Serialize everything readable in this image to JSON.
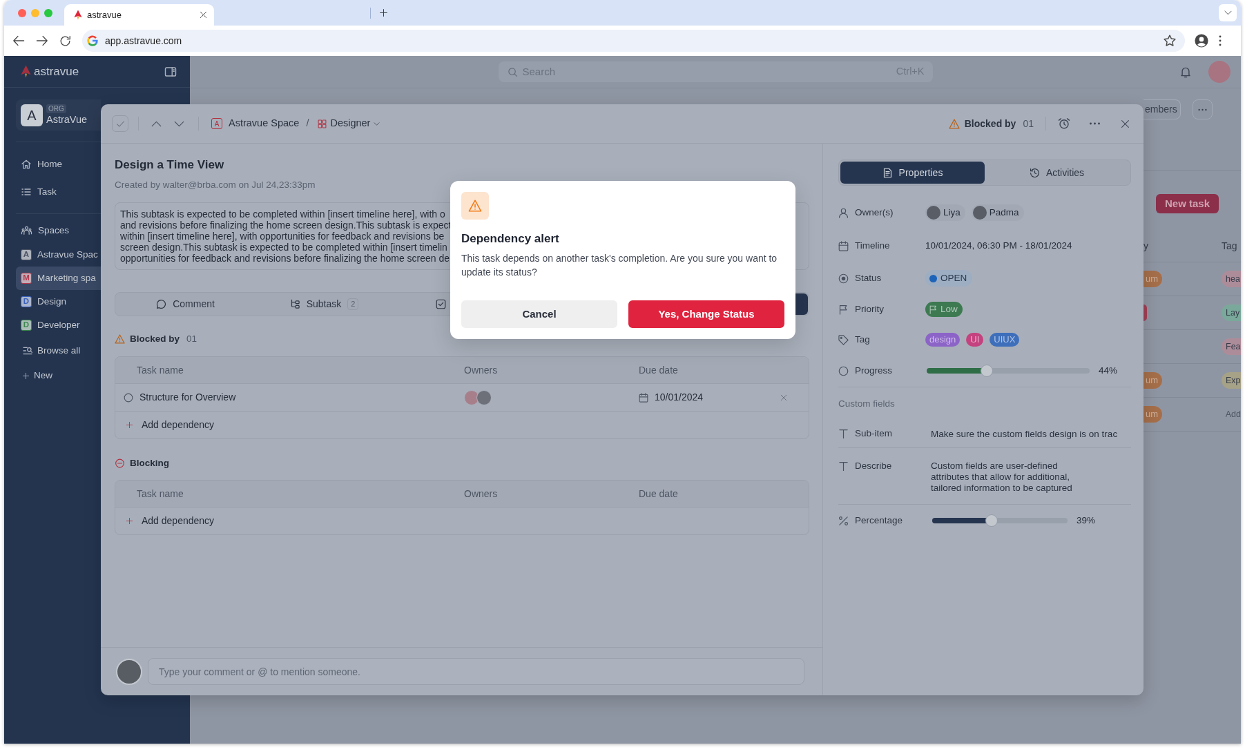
{
  "browser": {
    "tab_title": "astravue",
    "url": "app.astravue.com"
  },
  "sidebar": {
    "brand": "astravue",
    "org": {
      "initial": "A",
      "tag": "ORG",
      "name": "AstraVue"
    },
    "nav": [
      {
        "kind": "home",
        "label": "Home",
        "selected": false
      },
      {
        "kind": "task",
        "label": "Task",
        "selected": false
      }
    ],
    "spaces_heading": "Spaces",
    "spaces": [
      {
        "initial": "A",
        "name": "Astravue Spac",
        "color": "#4b5262",
        "selected": false
      },
      {
        "initial": "M",
        "name": "Marketing spa",
        "color": "#b3374d",
        "selected": true
      },
      {
        "initial": "D",
        "name": "Design",
        "color": "#3b62bd",
        "selected": false
      },
      {
        "initial": "D",
        "name": "Developer",
        "color": "#3c874c",
        "selected": false
      }
    ],
    "actions": [
      {
        "kind": "browse",
        "label": "Browse all"
      },
      {
        "kind": "new",
        "label": "New"
      }
    ]
  },
  "header": {
    "search": {
      "placeholder": "Search",
      "shortcut": "Ctrl+K"
    }
  },
  "page": {
    "toolbar_button": "embers",
    "new_task_button": "New task",
    "columns": [
      "y",
      "Tag"
    ],
    "rows": [
      {
        "priority": {
          "text": "um",
          "color": "#a66f4a"
        },
        "tag": {
          "text": "hea",
          "color": "#ad8c9a"
        }
      },
      {
        "priority": {
          "color": "#a23f55"
        },
        "tag": {
          "text": "Lay",
          "color": "#7aa99b"
        }
      },
      {
        "tag": {
          "text": "Fea",
          "color": "#ad8c9a"
        }
      },
      {
        "priority": {
          "text": "um",
          "color": "#a66f4a"
        },
        "tag": {
          "text": "Exp",
          "color": "#a6a287"
        }
      },
      {
        "priority": {
          "text": "um",
          "color": "#a66f4a"
        },
        "tag": {
          "text": "Add"
        }
      }
    ]
  },
  "task": {
    "breadcrumb": {
      "space_initial": "A",
      "space": "Astravue Space",
      "separator": "/",
      "list": "Designer"
    },
    "blocked": {
      "label": "Blocked by",
      "count": "01"
    },
    "title": "Design a Time View",
    "created_by": "Created by walter@brba.com on Jul 24,23:33pm",
    "description_lines": [
      "This subtask is expected to be completed within [insert timeline here], with o",
      "and revisions before finalizing the home screen design.This subtask is expect",
      "within [insert timeline here], with opportunities for feedback and revisions be",
      "screen design.This subtask is expected to be completed within [insert timelin",
      "opportunities for feedback and revisions before finalizing the home screen de"
    ],
    "tabs": [
      {
        "kind": "comment",
        "label": "Comment",
        "selected": false
      },
      {
        "kind": "subtask",
        "label": "Subtask",
        "count": "2",
        "selected": false
      },
      {
        "kind": "checklist",
        "selected": false
      },
      {
        "kind": "covered",
        "selected": true
      }
    ],
    "blocked_by": {
      "label": "Blocked by",
      "count": "01",
      "columns": [
        "Task name",
        "Owners",
        "Due date"
      ],
      "rows": [
        {
          "name": "Structure for Overview",
          "owners": [
            {
              "kind": "photo"
            },
            {
              "kind": "photo"
            }
          ],
          "due": "10/01/2024"
        }
      ],
      "add_label": "Add dependency"
    },
    "blocking": {
      "label": "Blocking",
      "columns": [
        "Task name",
        "Owners",
        "Due date"
      ],
      "add_label": "Add dependency"
    },
    "comment_placeholder": "Type your comment or @ to mention someone.",
    "panel_tabs": [
      {
        "kind": "properties",
        "label": "Properties",
        "selected": true
      },
      {
        "kind": "activities",
        "label": "Activities",
        "selected": false
      }
    ],
    "properties": [
      {
        "kind": "owners",
        "label": "Owner(s)",
        "owners": [
          {
            "name": "Liya"
          },
          {
            "name": "Padma"
          }
        ]
      },
      {
        "kind": "timeline",
        "label": "Timeline",
        "value": "10/01/2024, 06:30 PM - 18/01/2024"
      },
      {
        "kind": "status",
        "label": "Status",
        "value": "OPEN",
        "color": "#1d64b9"
      },
      {
        "kind": "priority",
        "label": "Priority",
        "value": "Low",
        "color": "#3d7a52"
      },
      {
        "kind": "tags",
        "label": "Tag",
        "tags": [
          {
            "text": "design",
            "color": "#8c64c8"
          },
          {
            "text": "UI",
            "color": "#c4427f"
          },
          {
            "text": "UIUX",
            "color": "#3e6fbb"
          }
        ]
      },
      {
        "kind": "progress",
        "label": "Progress",
        "level": 0.37,
        "reading": "44%"
      }
    ],
    "custom_fields_heading": "Custom fields",
    "custom_fields": [
      {
        "kind": "text",
        "label": "Sub-item",
        "value": "Make sure the custom fields design is on trac"
      },
      {
        "kind": "text",
        "label": "Describe",
        "value": "Custom fields are user-defined attributes that allow for additional, tailored information to be captured"
      },
      {
        "kind": "percent",
        "label": "Percentage",
        "level": 0.44,
        "reading": "39%"
      }
    ]
  },
  "alert": {
    "title": "Dependency alert",
    "message": "This task depends on another task's completion. Are you sure you want to update its status?",
    "buttons": [
      {
        "kind": "secondary",
        "label": "Cancel"
      },
      {
        "kind": "danger",
        "label": "Yes, Change Status"
      }
    ]
  }
}
